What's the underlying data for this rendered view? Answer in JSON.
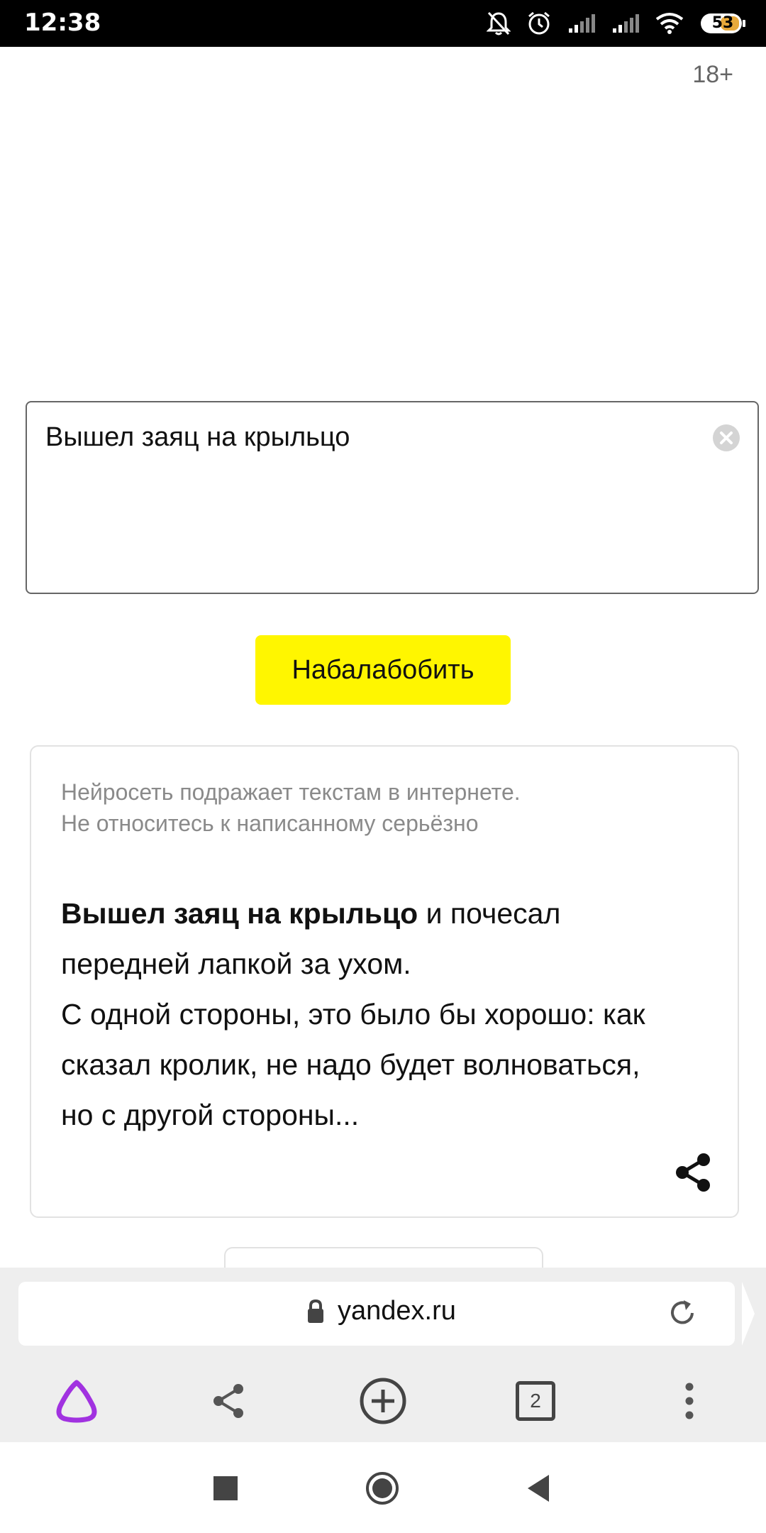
{
  "status_bar": {
    "time": "12:38",
    "battery": "53",
    "icons": [
      "bell-off-icon",
      "alarm-icon",
      "signal-icon",
      "signal-icon",
      "wifi-icon",
      "battery-icon"
    ]
  },
  "age_rating": "18+",
  "input": {
    "value": "Вышел заяц на крыльцо",
    "clear_icon": "close-icon"
  },
  "action_button": "Набалабобить",
  "result": {
    "disclaimer_line1": "Нейросеть подражает текстам в интернете.",
    "disclaimer_line2": "Не относитесь к написанному серьёзно",
    "bold_part": "Вышел заяц на крыльцо",
    "line1_rest": " и почесал",
    "line2": "передней лапкой за ухом.",
    "line3": "С одной стороны, это было бы хорошо: как",
    "line4": "сказал кролик, не надо будет волноваться,",
    "line5": "но с другой стороны...",
    "share_icon": "share-icon"
  },
  "browser": {
    "url": "yandex.ru",
    "tabs_count": "2",
    "toolbar_icons": [
      "alice-icon",
      "share-icon",
      "new-tab-icon",
      "tabs-icon",
      "more-icon"
    ]
  },
  "colors": {
    "accent_yellow": "#fff600",
    "alice_purple": "#a132e0"
  }
}
